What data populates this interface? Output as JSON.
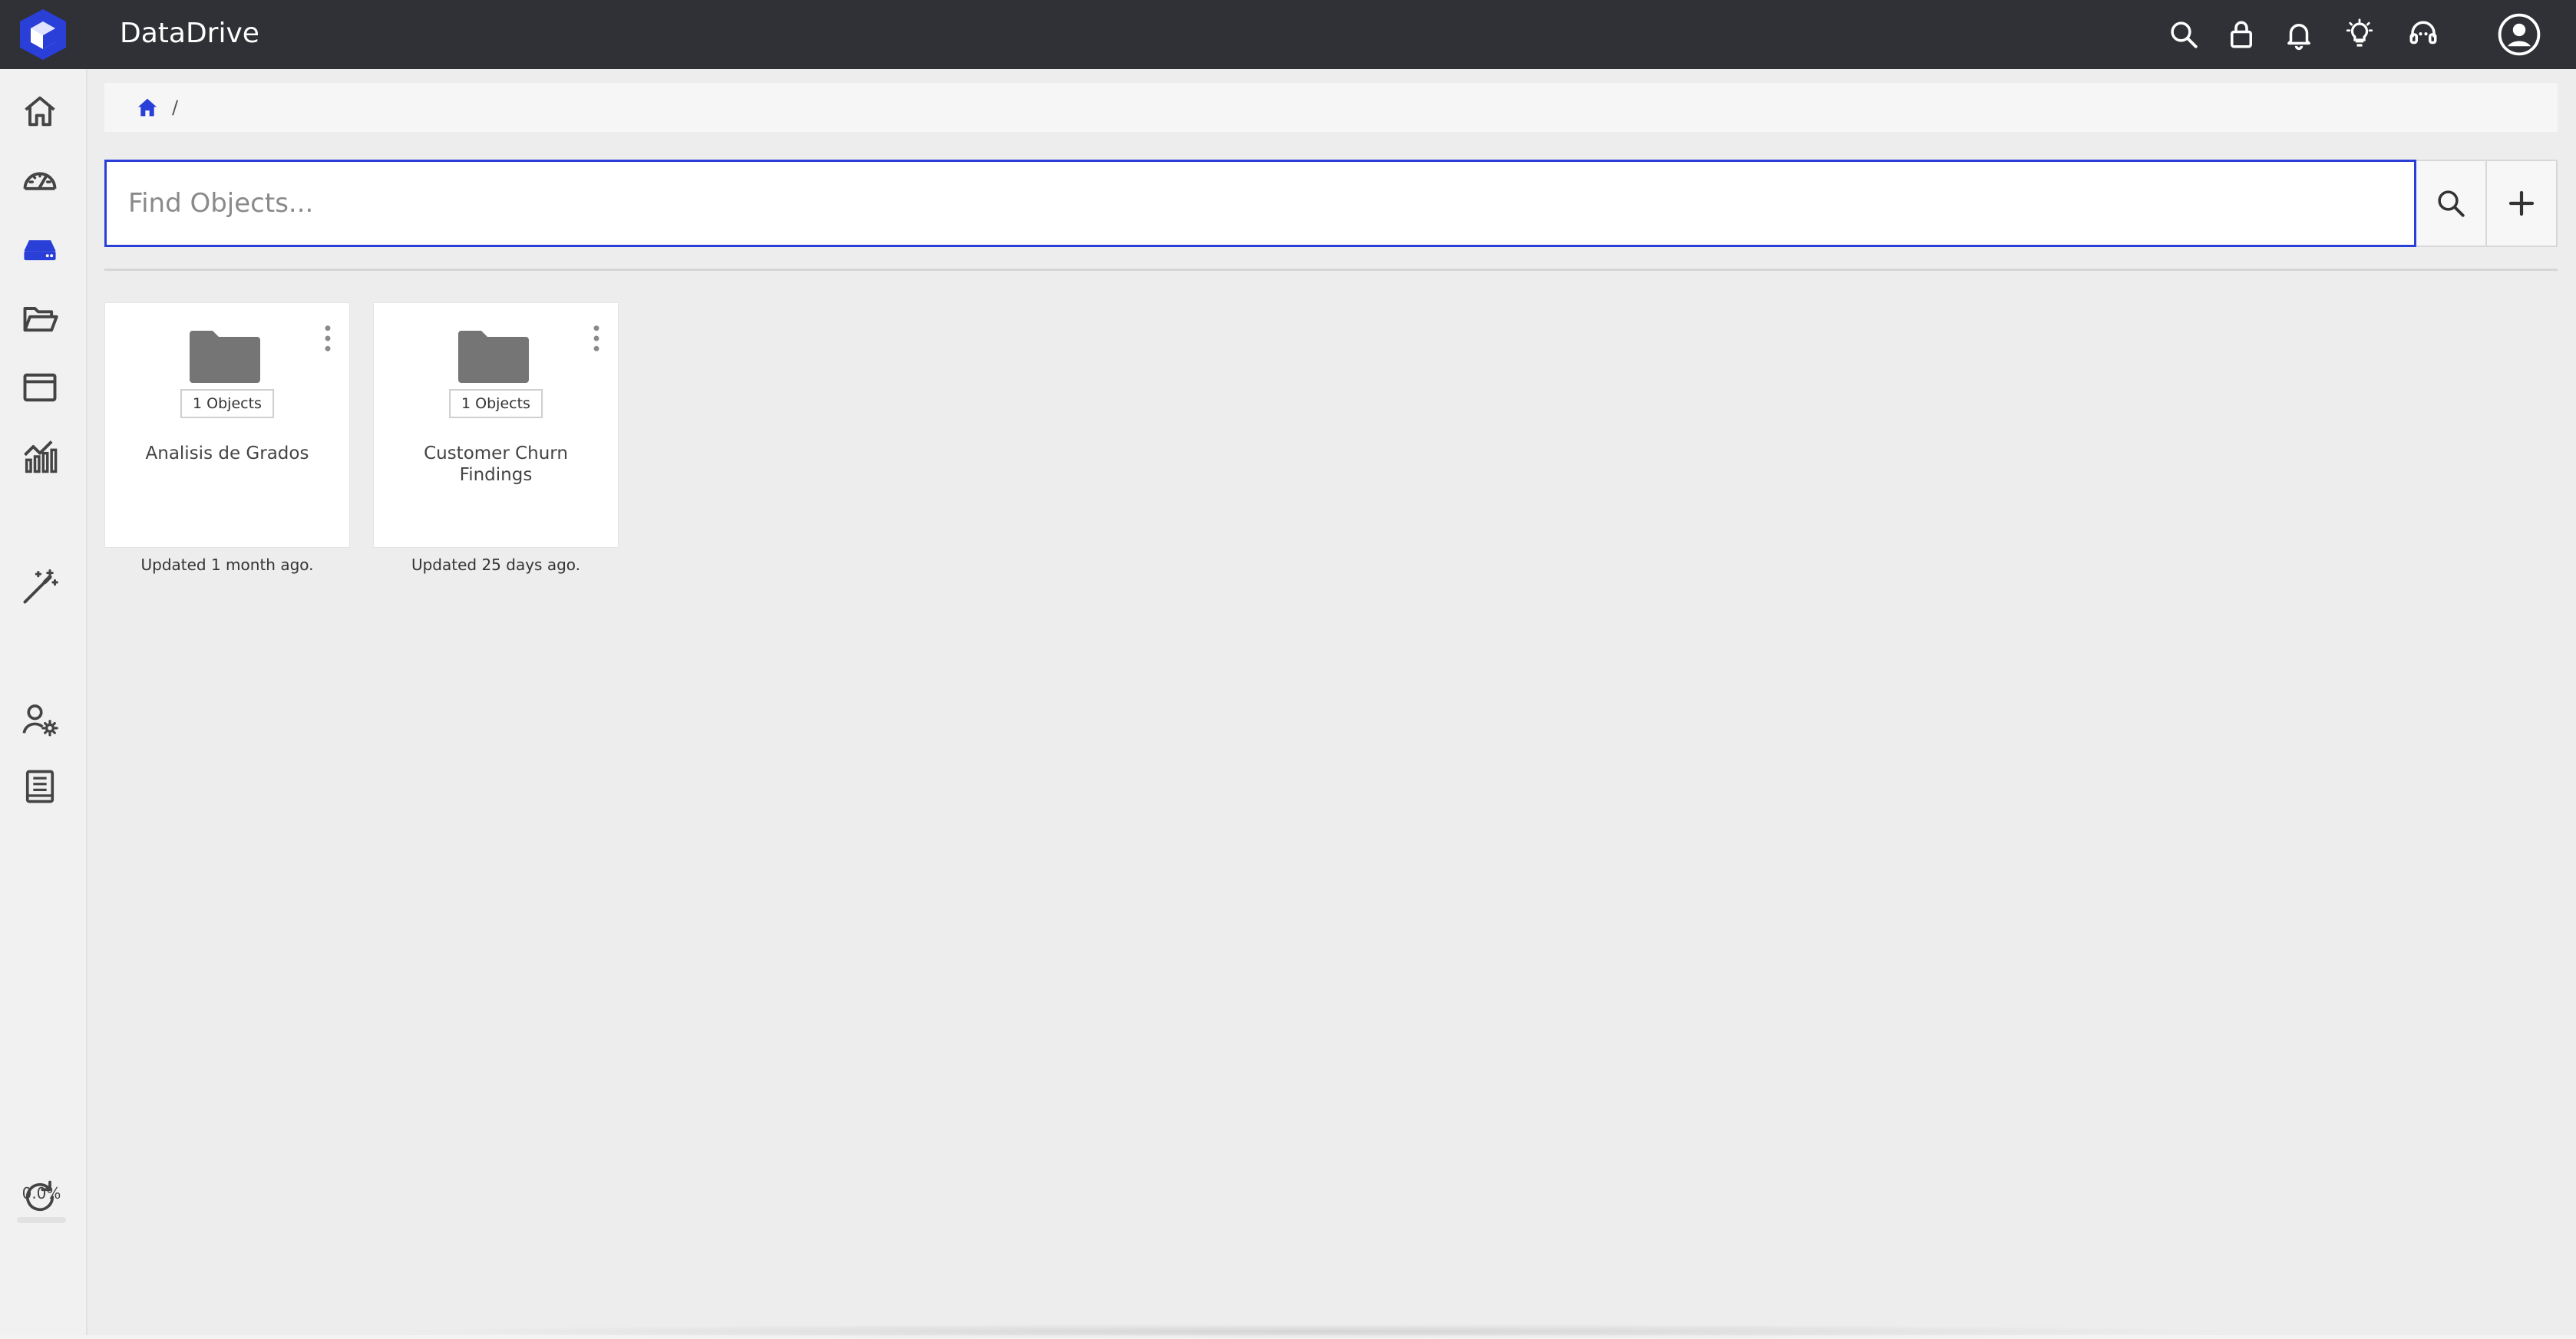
{
  "app": {
    "title": "DataDrive",
    "brand_color": "#2a3ed8"
  },
  "topbar": {
    "icons": [
      "search-icon",
      "lock-icon",
      "bell-icon",
      "lightbulb-icon",
      "support-headset-icon",
      "account-icon"
    ]
  },
  "sidebar": {
    "items": [
      {
        "name": "home-icon"
      },
      {
        "name": "dashboard-gauge-icon"
      },
      {
        "name": "drive-icon",
        "active": true
      },
      {
        "name": "folder-open-icon"
      },
      {
        "name": "window-icon"
      },
      {
        "name": "analytics-chart-icon"
      },
      {
        "name": "magic-wand-icon"
      },
      {
        "name": "user-settings-icon"
      },
      {
        "name": "book-icon"
      },
      {
        "name": "refresh-icon"
      }
    ],
    "progress": {
      "label": "0.0%",
      "value": 0.0
    }
  },
  "breadcrumb": {
    "separator": "/"
  },
  "search": {
    "placeholder": "Find Objects..."
  },
  "folders": [
    {
      "title": "Analisis de Grados",
      "count": "1 Objects",
      "updated": "Updated 1 month ago."
    },
    {
      "title": "Customer Churn Findings",
      "count": "1 Objects",
      "updated": "Updated 25 days ago."
    }
  ]
}
